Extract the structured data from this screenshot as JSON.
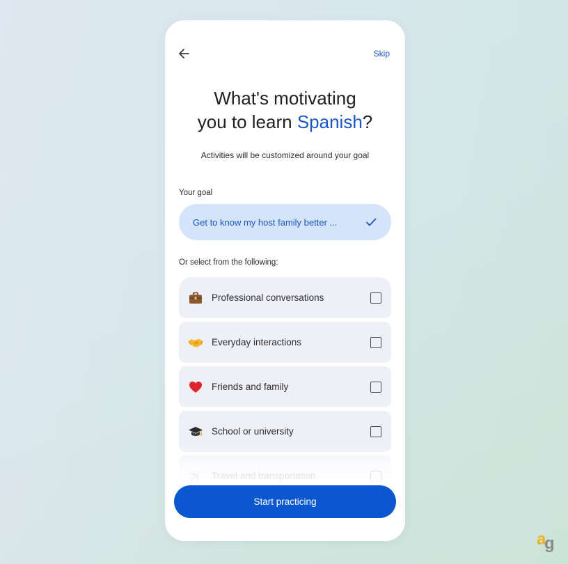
{
  "header": {
    "back_icon": "arrow-left-icon",
    "skip_label": "Skip"
  },
  "title": {
    "line1": "What's motivating",
    "line2_prefix": "you to learn ",
    "language": "Spanish",
    "line2_suffix": "?"
  },
  "subtitle": "Activities will be customized around your goal",
  "goal": {
    "label": "Your goal",
    "value": "Get to know my host family better ...",
    "selected_icon": "checkmark-icon"
  },
  "options_label": "Or select from the following:",
  "options": [
    {
      "label": "Professional conversations",
      "icon": "briefcase-icon",
      "checked": false
    },
    {
      "label": "Everyday interactions",
      "icon": "handshake-icon",
      "checked": false
    },
    {
      "label": "Friends and family",
      "icon": "heart-icon",
      "checked": false
    },
    {
      "label": "School or university",
      "icon": "graduation-cap-icon",
      "checked": false
    },
    {
      "label": "Travel and transportation",
      "icon": "airplane-icon",
      "checked": false
    }
  ],
  "start_button": "Start practicing",
  "colors": {
    "accent": "#1a56c7",
    "primary_button": "#0b57d0",
    "goal_pill": "#d4e4fb",
    "option_bg": "#eef0f6"
  },
  "watermark": "ag"
}
